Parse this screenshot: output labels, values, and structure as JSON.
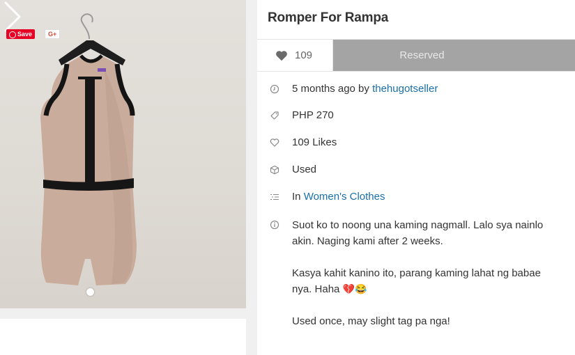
{
  "listing": {
    "title": "Romper For Rampa",
    "likes_button": "109",
    "status_button": "Reserved",
    "posted_prefix": "5 months ago by",
    "seller": "thehugotseller",
    "price": "PHP 270",
    "likes_text": "109 Likes",
    "condition": "Used",
    "category_prefix": "In",
    "category": "Women's Clothes",
    "description": [
      "Suot ko to noong una kaming nagmall. Lalo sya nainlo",
      "akin. Naging kami after 2 weeks.",
      "Kasya kahit kanino ito, parang kaming lahat ng babae",
      "nya. Haha",
      "Used once, may slight tag pa nga!"
    ],
    "emoji": "💔😂"
  },
  "share": {
    "save_label": "Save",
    "gplus_label": "G+"
  },
  "icons": {
    "time": "clock-icon",
    "price": "tag-icon",
    "likes": "heart-outline-icon",
    "condition": "box-icon",
    "category": "list-icon",
    "description": "info-icon",
    "carousel_next": "chevron-right-icon"
  },
  "colors": {
    "link": "#1a6fa8",
    "reserved_bg": "#a4a4a4",
    "save_bg": "#e60023"
  }
}
